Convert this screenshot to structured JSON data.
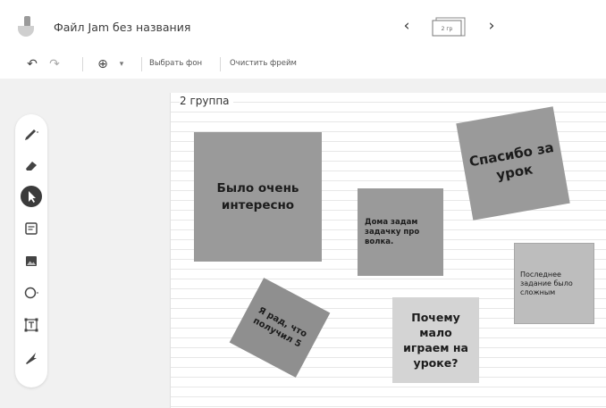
{
  "app": {
    "title": "Файл Jam без названия",
    "frame_thumb_label": "2 гр"
  },
  "nav": {
    "prev": "‹",
    "next": "›"
  },
  "toolbar": {
    "undo": "↶",
    "redo": "↷",
    "zoom": "⊕",
    "zoom_dropdown": "▾",
    "set_background": "Выбрать фон",
    "clear_frame": "Очистить фрейм"
  },
  "tools": [
    {
      "icon": "pen-icon",
      "active": false
    },
    {
      "icon": "eraser-icon",
      "active": false
    },
    {
      "icon": "select-arrow-icon",
      "active": true
    },
    {
      "icon": "sticky-note-icon",
      "active": false
    },
    {
      "icon": "image-icon",
      "active": false
    },
    {
      "icon": "circle-icon",
      "active": false
    },
    {
      "icon": "text-box-icon",
      "active": false
    },
    {
      "icon": "laser-icon",
      "active": false
    }
  ],
  "frame": {
    "label": "2 группа",
    "notes": [
      {
        "text": "Было очень интересно",
        "color": "#9a9a9a",
        "rotation_deg": 0
      },
      {
        "text": "Дома задам задачку про волка.",
        "color": "#9a9a9a",
        "rotation_deg": 0
      },
      {
        "text": "Спасибо за урок",
        "color": "#9a9a9a",
        "rotation_deg": -10
      },
      {
        "text": "Последнее задание было сложным",
        "color": "#bdbdbd",
        "rotation_deg": 0
      },
      {
        "text": "Я рад, что получил 5",
        "color": "#8f8f8f",
        "rotation_deg": 28
      },
      {
        "text": "Почему мало играем на уроке?",
        "color": "#d4d4d4",
        "rotation_deg": 0
      }
    ]
  }
}
